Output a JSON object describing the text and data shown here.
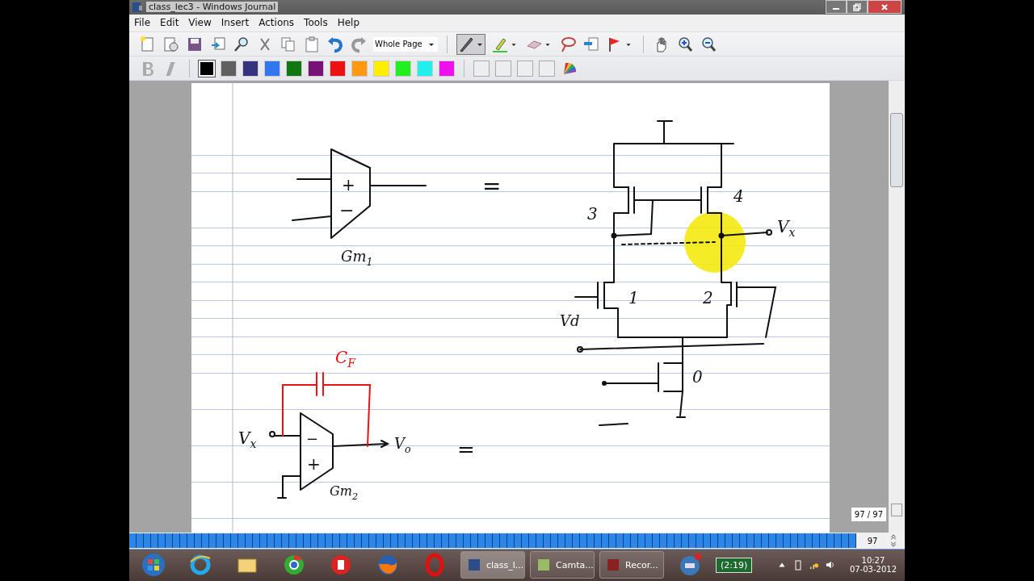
{
  "window": {
    "title": "class_lec3 - Windows Journal"
  },
  "menu": [
    "File",
    "Edit",
    "View",
    "Insert",
    "Actions",
    "Tools",
    "Help"
  ],
  "toolbar": {
    "zoom": "Whole Page",
    "pen_selected": true
  },
  "swatches": [
    {
      "color": "#000000",
      "selected": true
    },
    {
      "color": "#606060",
      "selected": false
    },
    {
      "color": "#333380",
      "selected": false
    },
    {
      "color": "#3377ee",
      "selected": false
    },
    {
      "color": "#117711",
      "selected": false
    },
    {
      "color": "#771177",
      "selected": false
    },
    {
      "color": "#ee1111",
      "selected": false
    },
    {
      "color": "#ff9911",
      "selected": false
    },
    {
      "color": "#ffee00",
      "selected": false
    },
    {
      "color": "#22ee22",
      "selected": false
    },
    {
      "color": "#22eeee",
      "selected": false
    },
    {
      "color": "#ee11ee",
      "selected": false
    }
  ],
  "ink_labels": [
    {
      "text": "+",
      "color": "#111111"
    },
    {
      "text": "−",
      "color": "#111111"
    },
    {
      "text": "Gm$_{1}$",
      "color": "#111111"
    },
    {
      "text": "=",
      "color": "#111111"
    },
    {
      "text": "3",
      "color": "#111111"
    },
    {
      "text": "4",
      "color": "#111111"
    },
    {
      "text": "V$_{x}$",
      "color": "#111111"
    },
    {
      "text": "1",
      "color": "#111111"
    },
    {
      "text": "2",
      "color": "#111111"
    },
    {
      "text": "Vd",
      "color": "#111111"
    },
    {
      "text": "0",
      "color": "#111111"
    },
    {
      "text": "C$_{F}$",
      "color": "#ee1111"
    },
    {
      "text": "V$_{x}$",
      "color": "#111111"
    },
    {
      "text": "−",
      "color": "#111111"
    },
    {
      "text": "+",
      "color": "#111111"
    },
    {
      "text": "V$_{o}$",
      "color": "#111111"
    },
    {
      "text": "=",
      "color": "#111111"
    },
    {
      "text": "Gm$_{2}$",
      "color": "#111111"
    }
  ],
  "page_indicator": "97 / 97",
  "page_number": "97",
  "taskbar": {
    "tasks": [
      {
        "label": "class_l...",
        "selected": true
      },
      {
        "label": "Camta...",
        "selected": false
      },
      {
        "label": "Recor...",
        "selected": false
      }
    ],
    "battery": "(2:19)",
    "time": "10:27",
    "date": "07-03-2012"
  }
}
